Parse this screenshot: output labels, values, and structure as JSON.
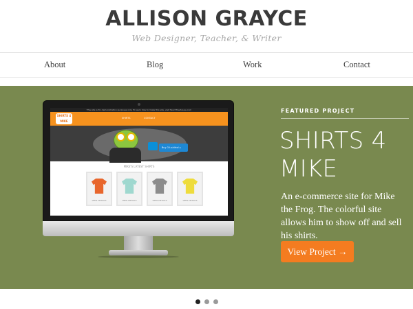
{
  "header": {
    "title": "ALLISON GRAYCE",
    "tagline": "Web Designer, Teacher, & Writer"
  },
  "nav": {
    "items": [
      {
        "label": "About"
      },
      {
        "label": "Blog"
      },
      {
        "label": "Work"
      },
      {
        "label": "Contact"
      }
    ]
  },
  "featured": {
    "label": "FEATURED PROJECT",
    "title_line1": "SHIRTS 4",
    "title_line2": "MIKE",
    "description": "An e-commerce site for Mike the Frog. The colorful site allows him to show off and sell his shirts.",
    "button_label": "View Project →",
    "accent_color": "#f47c20",
    "background_color": "#79894f"
  },
  "mockup": {
    "topbar_text": "This site is for demonstration purposes only. To learn how to make this site, visit TeachTreehouse.com",
    "logo_text": "SHIRTS 4 MIKE",
    "nav_tabs": [
      "SHIRTS",
      "CONTACT"
    ],
    "promo_text": "Buy 3 t-shirts! ▸",
    "section_title": "MIKE'S LATEST SHIRTS",
    "shirts": [
      {
        "color": "#e8662c",
        "caption": "VIEW DETAILS"
      },
      {
        "color": "#9fd8cf",
        "caption": "VIEW DETAILS"
      },
      {
        "color": "#8c8c8c",
        "caption": "VIEW DETAILS"
      },
      {
        "color": "#eedc3c",
        "caption": "VIEW DETAILS"
      }
    ]
  },
  "carousel": {
    "count": 3,
    "active_index": 0
  }
}
